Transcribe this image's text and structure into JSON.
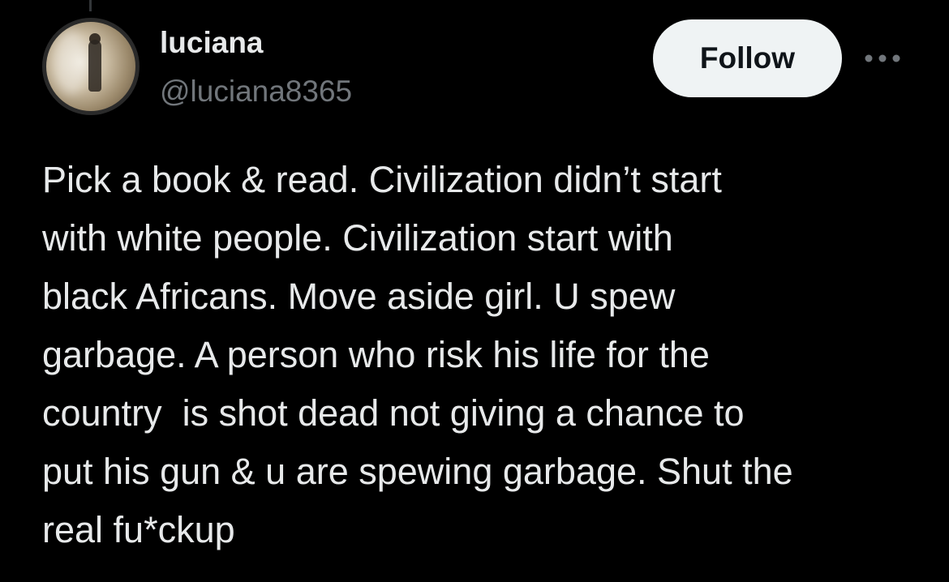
{
  "user": {
    "display_name": "luciana",
    "handle": "@luciana8365"
  },
  "actions": {
    "follow_label": "Follow",
    "more_icon": "more-horizontal-icon"
  },
  "tweet": {
    "text": "Pick a book & read. Civilization didn’t start\nwith white people. Civilization start with\nblack Africans. Move aside girl. U spew\ngarbage. A person who risk his life for the\ncountry  is shot dead not giving a chance to\nput his gun & u are spewing garbage. Shut the\nreal fu*ckup"
  },
  "colors": {
    "background": "#000000",
    "primary_text": "#e7e9ea",
    "secondary_text": "#71767b",
    "follow_bg": "#eff3f4",
    "follow_text": "#0f1419"
  }
}
